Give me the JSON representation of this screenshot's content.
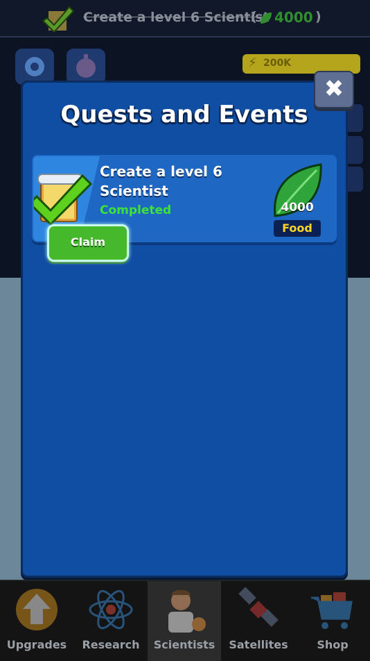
{
  "banner": {
    "quest_text": "Create a level 6 Scientist",
    "open_paren": "(",
    "reward_amount": "4000",
    "close_paren": ")"
  },
  "top_bar": {
    "energy_value": "200K"
  },
  "modal": {
    "title": "Quests and Events",
    "close_symbol": "✖"
  },
  "quest": {
    "title": "Create a level 6 Scientist",
    "status": "Completed",
    "claim_label": "Claim",
    "reward_amount": "4000",
    "reward_label": "Food"
  },
  "nav": {
    "items": [
      {
        "label": "Upgrades"
      },
      {
        "label": "Research"
      },
      {
        "label": "Scientists"
      },
      {
        "label": "Satellites"
      },
      {
        "label": "Shop"
      }
    ],
    "active": "Scientists"
  },
  "colors": {
    "modal_bg": "#0f4ea3",
    "card_bg": "#1e67c2",
    "claim_green": "#45b82c",
    "status_green": "#3ee33a",
    "food_yellow": "#ffd52a"
  }
}
